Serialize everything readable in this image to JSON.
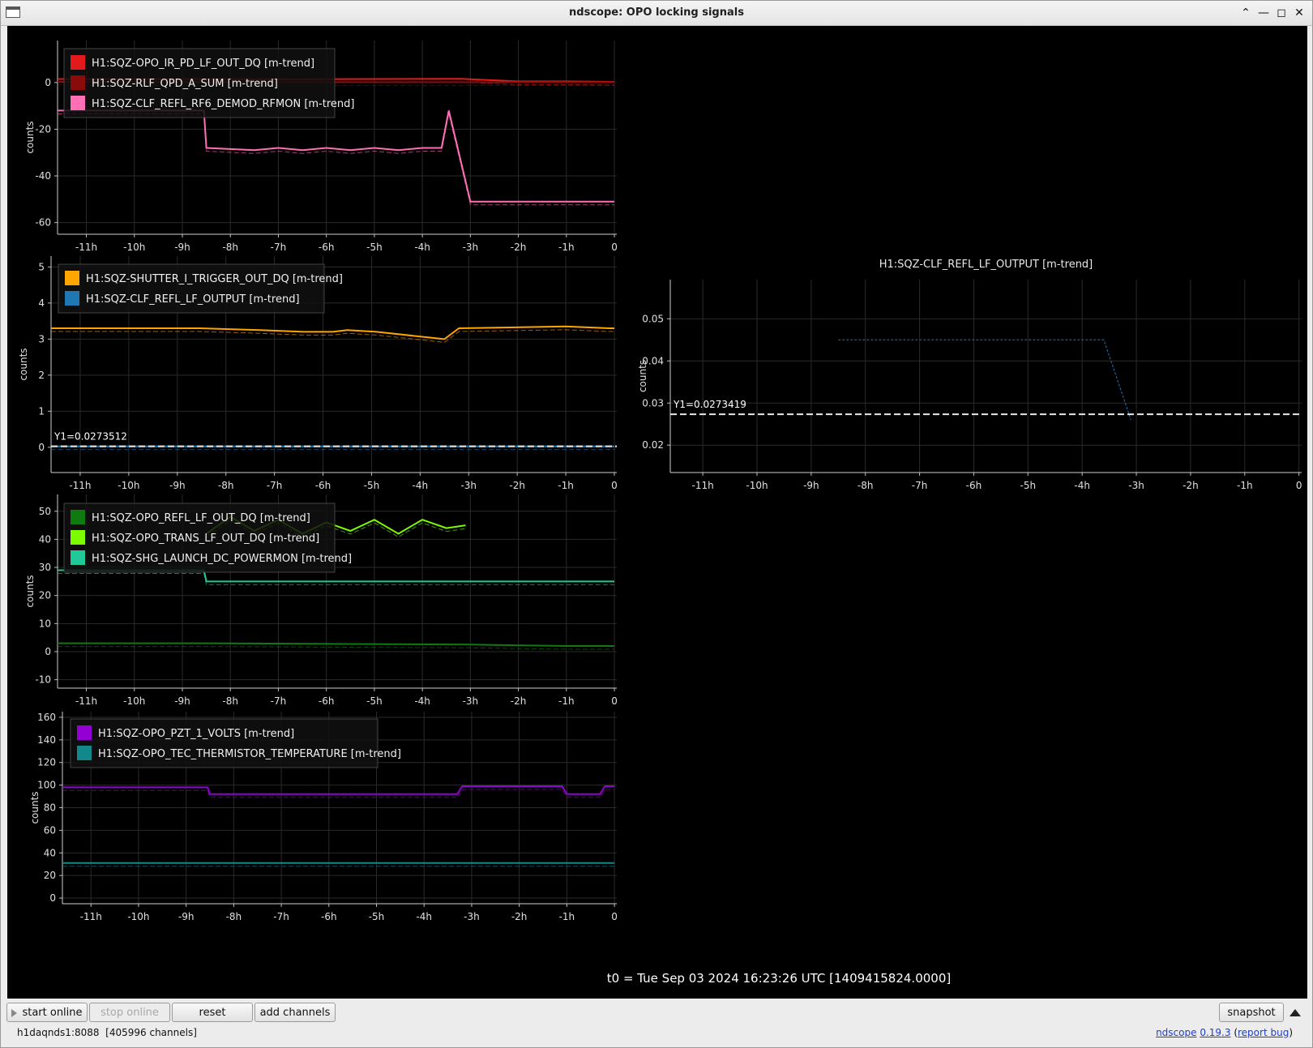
{
  "window": {
    "title": "ndscope: OPO locking signals"
  },
  "t0_label": "t0 = Tue Sep 03 2024 16:23:26 UTC [1409415824.0000]",
  "toolbar": {
    "start_online": "start online",
    "stop_online": "stop online",
    "reset": "reset",
    "add_channels": "add channels",
    "snapshot": "snapshot"
  },
  "status": {
    "server": "h1daqnds1:8088",
    "channels": "[405996 channels]",
    "app_name": "ndscope",
    "version": "0.19.3",
    "report_bug": "report bug"
  },
  "chart_data": [
    {
      "type": "line",
      "ylabel": "counts",
      "ylim": [
        -65,
        18
      ],
      "yticks": [
        "0",
        "-20",
        "-40",
        "-60"
      ],
      "xticks": [
        "-11h",
        "-10h",
        "-9h",
        "-8h",
        "-7h",
        "-6h",
        "-5h",
        "-4h",
        "-3h",
        "-2h",
        "-1h",
        "0"
      ],
      "legend_placement": "top-left",
      "series": [
        {
          "name": "H1:SQZ-OPO_IR_PD_LF_OUT_DQ [m-trend]",
          "color": "#e31a1c",
          "x": [
            -11.6,
            -9,
            -7,
            -5,
            -3.2,
            -2,
            -1,
            0
          ],
          "y": [
            1.5,
            1.5,
            1.4,
            1.5,
            1.6,
            0.5,
            0.5,
            0.3
          ]
        },
        {
          "name": "H1:SQZ-RLF_QPD_A_SUM [m-trend]",
          "color": "#8b0a0a",
          "x": [
            -11.6,
            -6,
            0
          ],
          "y": [
            0.3,
            0.2,
            0.1
          ]
        },
        {
          "name": "H1:SQZ-CLF_REFL_RF6_DEMOD_RFMON [m-trend]",
          "color": "#ff6fb5",
          "x": [
            -11.6,
            -8.55,
            -8.5,
            -7.5,
            -7,
            -6.5,
            -6,
            -5.5,
            -5,
            -4.5,
            -4,
            -3.6,
            -3.45,
            -3.0,
            -2,
            -1,
            0
          ],
          "y": [
            -12,
            -12,
            -28,
            -29,
            -28,
            -29,
            -28,
            -29,
            -28,
            -29,
            -28,
            -28,
            -12,
            -51,
            -51,
            -51,
            -51
          ]
        }
      ]
    },
    {
      "type": "line",
      "ylabel": "counts",
      "ylim": [
        -0.7,
        5.3
      ],
      "yticks": [
        "0",
        "1",
        "2",
        "3",
        "4",
        "5"
      ],
      "xticks": [
        "-11h",
        "-10h",
        "-9h",
        "-8h",
        "-7h",
        "-6h",
        "-5h",
        "-4h",
        "-3h",
        "-2h",
        "-1h",
        "0"
      ],
      "legend_placement": "top-left",
      "cursor_label": "Y1=0.0273512",
      "series": [
        {
          "name": "H1:SQZ-SHUTTER_I_TRIGGER_OUT_DQ [m-trend]",
          "color": "#ffa500",
          "x": [
            -11.6,
            -8.55,
            -7.3,
            -6.4,
            -5.8,
            -5.5,
            -4.9,
            -3.5,
            -3.2,
            -1.0,
            -0.1,
            0
          ],
          "y": [
            3.3,
            3.3,
            3.25,
            3.2,
            3.2,
            3.25,
            3.2,
            3.0,
            3.3,
            3.35,
            3.3,
            3.3
          ]
        },
        {
          "name": "H1:SQZ-CLF_REFL_LF_OUTPUT [m-trend]",
          "color": "#1f77b4",
          "x": [
            -11.6,
            0
          ],
          "y": [
            0.0273512,
            0.0273512
          ]
        }
      ]
    },
    {
      "type": "line",
      "ylabel": "counts",
      "ylim": [
        -13,
        56
      ],
      "yticks": [
        "50",
        "40",
        "30",
        "20",
        "10",
        "0",
        "-10"
      ],
      "xticks": [
        "-11h",
        "-10h",
        "-9h",
        "-8h",
        "-7h",
        "-6h",
        "-5h",
        "-4h",
        "-3h",
        "-2h",
        "-1h",
        "0"
      ],
      "legend_placement": "top-left",
      "series": [
        {
          "name": "H1:SQZ-OPO_REFL_LF_OUT_DQ [m-trend]",
          "color": "#0f7a0f",
          "x": [
            -11.6,
            -8.5,
            -3.0,
            -1.0,
            0
          ],
          "y": [
            3,
            3,
            2.5,
            2,
            2
          ]
        },
        {
          "name": "H1:SQZ-OPO_TRANS_LF_OUT_DQ [m-trend]",
          "color": "#7cfc00",
          "x": [
            -8.5,
            -8.0,
            -7.5,
            -7.0,
            -6.5,
            -6.0,
            -5.5,
            -5.0,
            -4.5,
            -4.0,
            -3.5,
            -3.1
          ],
          "y": [
            42,
            48,
            43,
            47,
            42,
            46,
            43,
            47,
            42,
            47,
            44,
            45
          ]
        },
        {
          "name": "H1:SQZ-SHG_LAUNCH_DC_POWERMON [m-trend]",
          "color": "#20c997",
          "x": [
            -11.6,
            -8.55,
            -8.5,
            -3,
            -1,
            0
          ],
          "y": [
            29,
            29,
            25,
            25,
            25,
            25
          ]
        }
      ]
    },
    {
      "type": "line",
      "ylabel": "counts",
      "ylim": [
        -5,
        165
      ],
      "yticks": [
        "160",
        "140",
        "120",
        "100",
        "80",
        "60",
        "40",
        "20",
        "0"
      ],
      "xticks": [
        "-11h",
        "-10h",
        "-9h",
        "-8h",
        "-7h",
        "-6h",
        "-5h",
        "-4h",
        "-3h",
        "-2h",
        "-1h",
        "0"
      ],
      "legend_placement": "top-left",
      "series": [
        {
          "name": "H1:SQZ-OPO_PZT_1_VOLTS [m-trend]",
          "color": "#9400d3",
          "x": [
            -11.6,
            -8.55,
            -8.5,
            -3.3,
            -3.2,
            -1.1,
            -1.0,
            -0.3,
            -0.2,
            0
          ],
          "y": [
            98,
            98,
            92,
            92,
            99,
            99,
            92,
            92,
            99,
            99
          ]
        },
        {
          "name": "H1:SQZ-OPO_TEC_THERMISTOR_TEMPERATURE [m-trend]",
          "color": "#11898a",
          "x": [
            -11.6,
            0
          ],
          "y": [
            31,
            31
          ]
        }
      ]
    },
    {
      "type": "line",
      "title": "H1:SQZ-CLF_REFL_LF_OUTPUT [m-trend]",
      "ylabel": "counts",
      "ylim": [
        0.0135,
        0.0593
      ],
      "yticks": [
        "0.05",
        "0.04",
        "0.03",
        "0.02"
      ],
      "xticks": [
        "-11h",
        "-10h",
        "-9h",
        "-8h",
        "-7h",
        "-6h",
        "-5h",
        "-4h",
        "-3h",
        "-2h",
        "-1h",
        "0"
      ],
      "cursor_label": "Y1=0.0273419",
      "series": [
        {
          "color": "#1f77b4",
          "x": [
            -8.5,
            -7.5,
            -6.5,
            -5.5,
            -4.5,
            -3.6,
            -3.1
          ],
          "y": [
            0.045,
            0.045,
            0.045,
            0.045,
            0.045,
            0.045,
            0.026
          ]
        }
      ]
    }
  ]
}
